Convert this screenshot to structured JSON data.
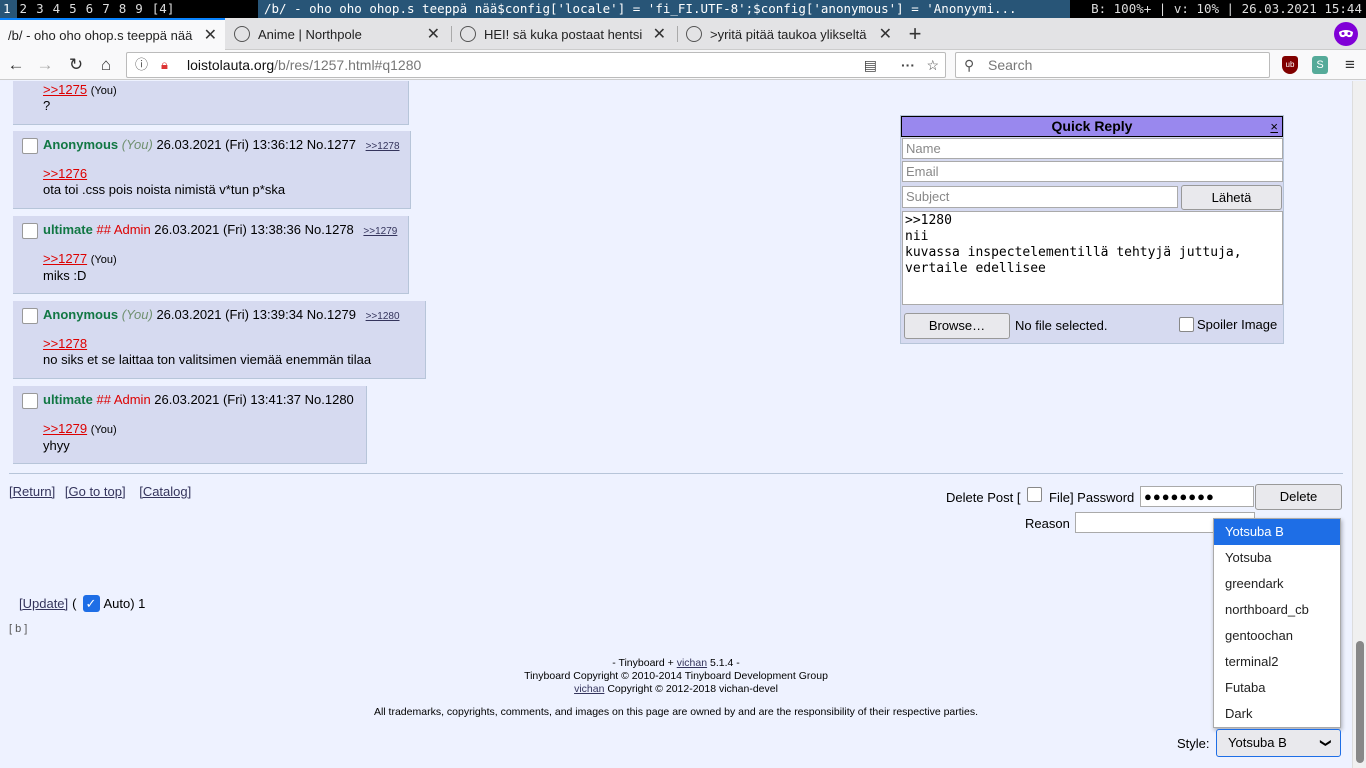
{
  "wm": {
    "workspaces": [
      "1",
      "2",
      "3",
      "4",
      "5",
      "6",
      "7",
      "8",
      "9",
      "[4]"
    ],
    "title": "/b/ - oho oho ohop.s teeppä nää$config['locale'] = 'fi_FI.UTF-8';$config['anonymous'] = 'Anonyymi...",
    "status": "B: 100%+ | v: 10% | 26.03.2021 15:44"
  },
  "tabs": [
    {
      "title": "/b/ - oho oho ohop.s teeppä nää"
    },
    {
      "title": "Anime | Northpole"
    },
    {
      "title": "HEI! sä kuka postaat hentsi"
    },
    {
      "title": ">yritä pitää taukoa ylikseltä"
    }
  ],
  "nav": {
    "url_domain": "loistolauta.org",
    "url_path": "/b/res/1257.html#q1280",
    "search_placeholder": "Search"
  },
  "posts": [
    {
      "link": ">>1275",
      "you": "(You)",
      "body": "?"
    },
    {
      "name": "Anonymous",
      "you": "(You)",
      "date": "26.03.2021 (Fri) 13:36:12",
      "no": "No.1277",
      "backlink": ">>1278",
      "quote": ">>1276",
      "body": "ota toi .css pois noista nimistä v*tun p*ska"
    },
    {
      "name": "ultimate",
      "cap": "## Admin",
      "date": "26.03.2021 (Fri) 13:38:36",
      "no": "No.1278",
      "backlink": ">>1279",
      "quote": ">>1277",
      "quote_you": "(You)",
      "body": "miks :D"
    },
    {
      "name": "Anonymous",
      "you": "(You)",
      "date": "26.03.2021 (Fri) 13:39:34",
      "no": "No.1279",
      "backlink": ">>1280",
      "quote": ">>1278",
      "body": "no siks et se laittaa ton valitsimen viemää enemmän tilaa"
    },
    {
      "name": "ultimate",
      "cap": "## Admin",
      "date": "26.03.2021 (Fri) 13:41:37",
      "no": "No.1280",
      "quote": ">>1279",
      "quote_you": "(You)",
      "body": "yhyy"
    }
  ],
  "quick_reply": {
    "title": "Quick Reply",
    "close": "×",
    "name_ph": "Name",
    "email_ph": "Email",
    "subject_ph": "Subject",
    "submit": "Lähetä",
    "message": ">>1280\nnii\nkuvassa inspectelementillä tehtyjä juttuja,\nvertaile edellisee",
    "browse": "Browse…",
    "no_file": "No file selected.",
    "spoiler": "Spoiler Image"
  },
  "bottom": {
    "return": "[Return]",
    "top": "[Go to top]",
    "catalog": "[Catalog]",
    "delete_post": "Delete Post [",
    "file": "File] Password",
    "password": "●●●●●●●●",
    "delete": "Delete",
    "reason": "Reason",
    "update": "[Update]",
    "auto_pre": "(",
    "auto": "Auto) 1",
    "boards": "[ b ]"
  },
  "style_select": {
    "label": "Style:",
    "selected": "Yotsuba B",
    "options": [
      "Yotsuba B",
      "Yotsuba",
      "greendark",
      "northboard_cb",
      "gentoochan",
      "terminal2",
      "Futaba",
      "Dark"
    ]
  },
  "footer": {
    "line1a": "- Tinyboard + ",
    "vichan": "vichan",
    "line1b": " 5.1.4 -",
    "line2": "Tinyboard Copyright © 2010-2014 Tinyboard Development Group",
    "line3b": " Copyright © 2012-2018 vichan-devel",
    "line4": "All trademarks, copyrights, comments, and images on this page are owned by and are the responsibility of their respective parties."
  }
}
